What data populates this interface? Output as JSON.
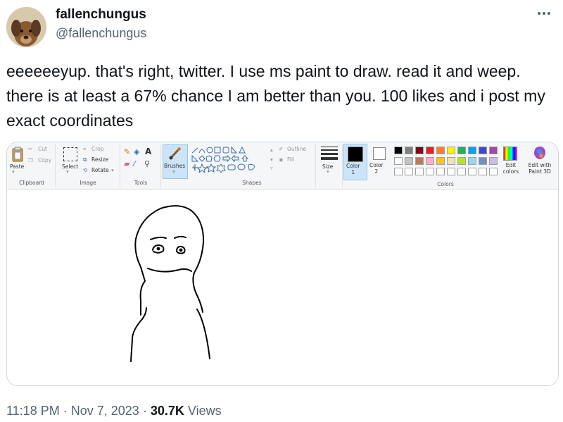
{
  "tweet": {
    "display_name": "fallenchungus",
    "handle": "@fallenchungus",
    "more_icon": "more-horizontal-icon",
    "text": "eeeeeeyup. that's right, twitter. I use ms paint to draw. read it and weep. there is at least a 67% chance I am better than you.  100 likes and i post my exact coordinates",
    "time": "11:18 PM",
    "sep1": "·",
    "date": "Nov 7, 2023",
    "sep2": "·",
    "views_count": "30.7K",
    "views_label": "Views"
  },
  "paint": {
    "clipboard": {
      "paste": "Paste",
      "cut": "Cut",
      "copy": "Copy",
      "label": "Clipboard"
    },
    "image": {
      "select": "Select",
      "crop": "Crop",
      "resize": "Resize",
      "rotate": "Rotate",
      "label": "Image"
    },
    "tools": {
      "label": "Tools"
    },
    "brushes": "Brushes",
    "shapes": {
      "outline": "Outline",
      "fill": "Fill",
      "label": "Shapes"
    },
    "size": "Size",
    "color1": "Color\n1",
    "color2": "Color\n2",
    "colors_label": "Colors",
    "edit_colors": "Edit colors",
    "edit_paint3d": "Edit with Paint 3D",
    "palette_row1": [
      "#000000",
      "#7f7f7f",
      "#880015",
      "#ed1c24",
      "#ff7f27",
      "#fff200",
      "#22b14c",
      "#00a2e8",
      "#3f48cc",
      "#a349a4"
    ],
    "palette_row2": [
      "#ffffff",
      "#c3c3c3",
      "#b97a57",
      "#ffaec9",
      "#ffc90e",
      "#efe4b0",
      "#b5e61d",
      "#99d9ea",
      "#7092be",
      "#c8bfe7"
    ]
  }
}
